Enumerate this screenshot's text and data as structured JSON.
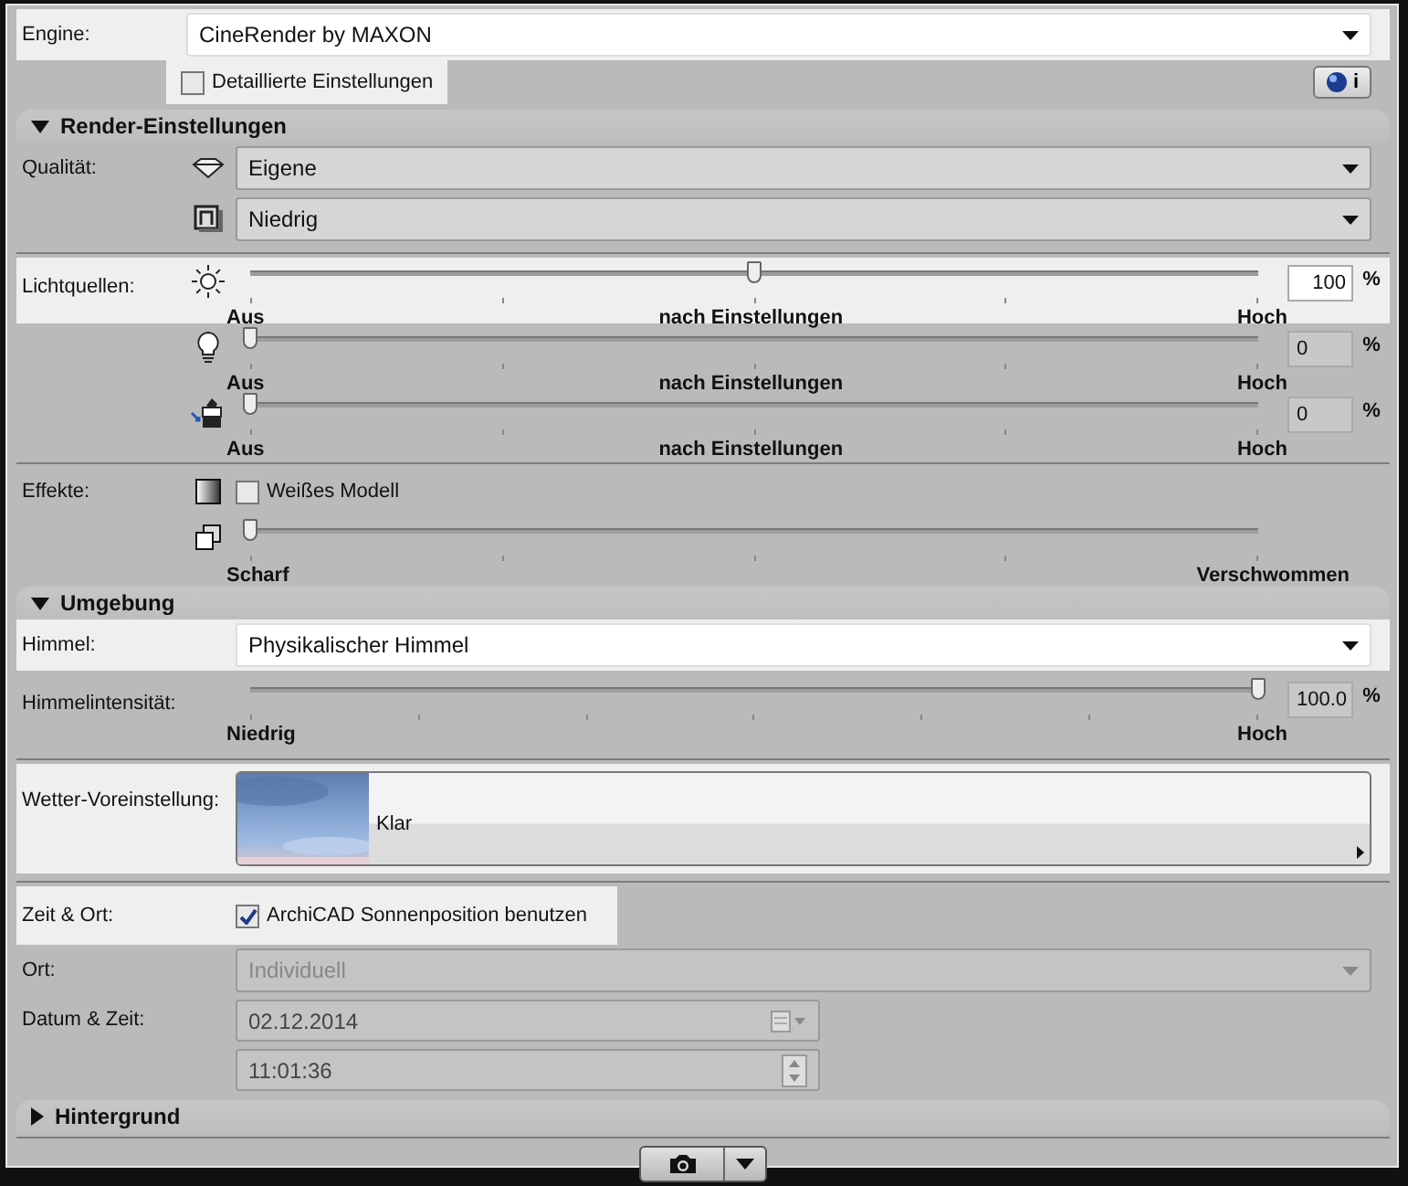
{
  "engine": {
    "label": "Engine:",
    "value": "CineRender by MAXON",
    "highlighted": true
  },
  "detailed_settings": {
    "text": "Detaillierte Einstellungen",
    "checked": false,
    "highlighted": true
  },
  "info_button": {
    "text": "i"
  },
  "sections": [
    {
      "title": "Render-Einstellungen",
      "expanded": true,
      "groups": [
        {
          "rows": [
            {
              "kind": "select",
              "label": "Qualität:",
              "value": "Eigene",
              "highlighted": false,
              "disabled": false
            },
            {
              "kind": "select",
              "value": "Niedrig",
              "highlighted": false,
              "disabled": false
            }
          ]
        },
        {
          "rows": [
            {
              "kind": "slider",
              "label": "Lichtquellen:",
              "level": 0.5,
              "value": "100",
              "unit": "%",
              "disabled": false,
              "highlighted": true,
              "scale": [
                "Aus",
                "nach Einstellungen",
                "Hoch"
              ]
            },
            {
              "kind": "slider",
              "level": 0,
              "value": "0",
              "unit": "%",
              "disabled": true,
              "highlighted": false,
              "scale": [
                "Aus",
                "nach Einstellungen",
                "Hoch"
              ]
            },
            {
              "kind": "slider",
              "level": 0,
              "value": "0",
              "unit": "%",
              "disabled": true,
              "highlighted": false,
              "scale": [
                "Aus",
                "nach Einstellungen",
                "Hoch"
              ]
            }
          ]
        },
        {
          "rows": [
            {
              "kind": "check",
              "label": "Effekte:",
              "text": "Weißes Modell",
              "checked": false,
              "highlighted": false
            },
            {
              "kind": "slider",
              "level": 0,
              "highlighted": false,
              "scale": [
                "Scharf",
                "Verschwommen"
              ]
            }
          ]
        }
      ]
    },
    {
      "title": "Umgebung",
      "expanded": true,
      "groups": [
        {
          "rows": [
            {
              "kind": "select",
              "label": "Himmel:",
              "value": "Physikalischer Himmel",
              "highlighted": true,
              "disabled": false
            },
            {
              "kind": "fine_slider",
              "label": "Himmelintensität:",
              "level": 1,
              "value": "100.0",
              "unit": "%",
              "disabled": true,
              "highlighted": false,
              "scale": [
                "Niedrig",
                "Hoch"
              ]
            }
          ]
        },
        {
          "rows": [
            {
              "kind": "preset",
              "label": "Wetter-Voreinstellung:",
              "value": "Klar",
              "highlighted": true
            }
          ]
        },
        {
          "rows": [
            {
              "kind": "check",
              "label": "Zeit & Ort:",
              "text": "ArchiCAD Sonnenposition benutzen",
              "checked": true,
              "highlighted": true
            },
            {
              "kind": "select",
              "label": "Ort:",
              "value": "Individuell",
              "highlighted": false,
              "disabled": true
            },
            {
              "kind": "date",
              "label": "Datum & Zeit:",
              "value": "02.12.2014",
              "disabled": true
            },
            {
              "kind": "time",
              "value": "11:01:36",
              "disabled": true
            }
          ]
        }
      ]
    },
    {
      "title": "Hintergrund",
      "expanded": false
    }
  ]
}
